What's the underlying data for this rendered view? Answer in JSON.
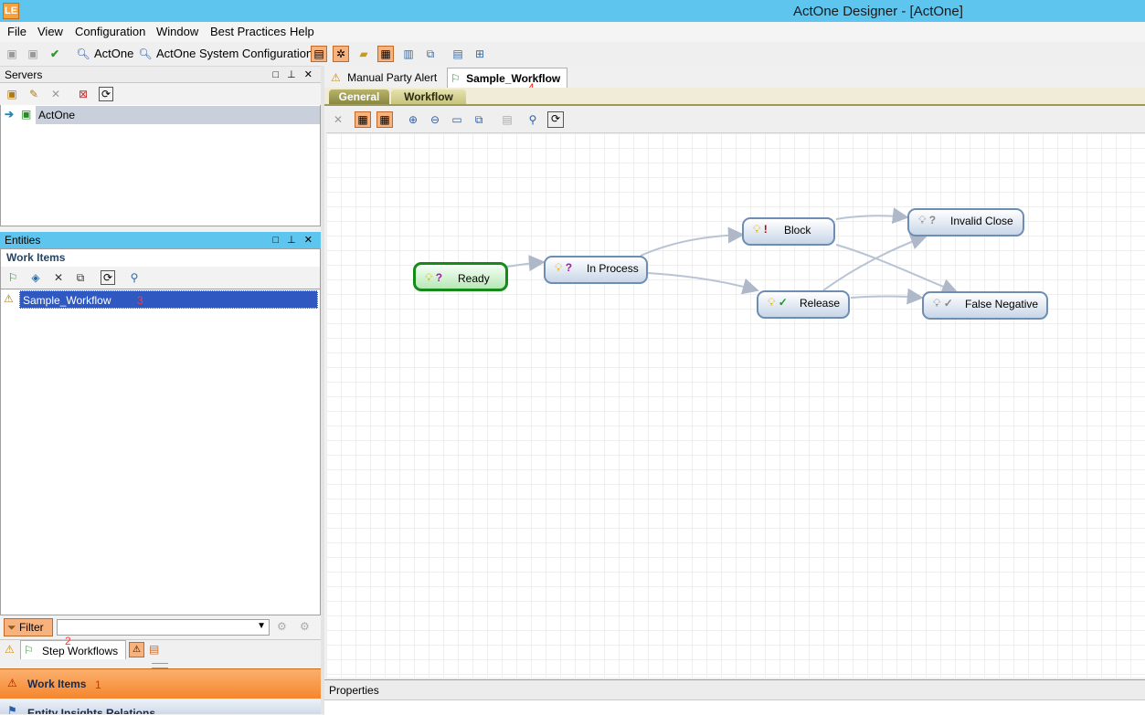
{
  "window": {
    "title": "ActOne Designer - [ActOne]",
    "app_icon": "LE"
  },
  "menu": [
    "File",
    "View",
    "Configuration",
    "Window",
    "Best Practices",
    "Help"
  ],
  "toolbar": {
    "actone_label": "ActOne",
    "system_config_label": "ActOne System Configuration"
  },
  "servers": {
    "title": "Servers",
    "items": [
      "ActOne"
    ]
  },
  "entities": {
    "title": "Entities",
    "section_title": "Work Items",
    "items": [
      {
        "label": "Sample_Workflow",
        "annotation": "3"
      }
    ],
    "filter": {
      "button_label": "Filter",
      "value": ""
    },
    "bottom_tabs": {
      "step_workflows_label": "Step Workflows",
      "step_workflows_annotation": "2"
    }
  },
  "nav": {
    "work_items_label": "Work Items",
    "work_items_annotation": "1",
    "entity_insights_label": "Entity Insights Relations"
  },
  "documents": {
    "tabs": [
      {
        "label": "Manual Party Alert",
        "icon": "warning-icon"
      },
      {
        "label": "Sample_Workflow",
        "icon": "workflow-icon",
        "annotation": "4"
      }
    ],
    "sub_tabs": [
      "General",
      "Workflow"
    ],
    "active_sub_tab": "Workflow"
  },
  "workflow": {
    "nodes": [
      {
        "id": "ready",
        "label": "Ready",
        "status_symbol": "?",
        "initial": true
      },
      {
        "id": "inprocess",
        "label": "In Process",
        "status_symbol": "?"
      },
      {
        "id": "block",
        "label": "Block",
        "status_symbol": "!"
      },
      {
        "id": "release",
        "label": "Release",
        "status_symbol": "✓"
      },
      {
        "id": "invalid",
        "label": "Invalid Close",
        "status_symbol": "?"
      },
      {
        "id": "falseneg",
        "label": "False Negative",
        "status_symbol": "✓"
      }
    ],
    "transitions": [
      [
        "ready",
        "inprocess"
      ],
      [
        "inprocess",
        "block"
      ],
      [
        "inprocess",
        "release"
      ],
      [
        "block",
        "invalid"
      ],
      [
        "block",
        "falseneg"
      ],
      [
        "release",
        "invalid"
      ],
      [
        "release",
        "falseneg"
      ]
    ]
  },
  "properties": {
    "title": "Properties"
  }
}
